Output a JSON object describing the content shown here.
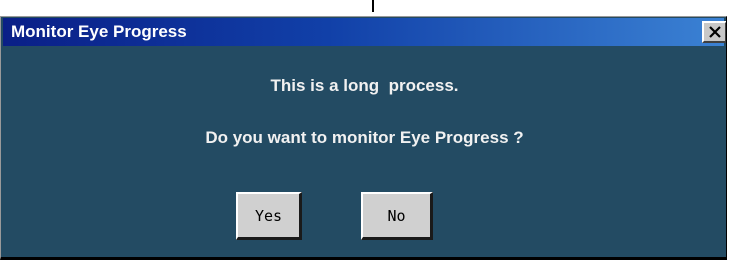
{
  "window": {
    "title": "Monitor Eye Progress"
  },
  "titlebar": {
    "close_icon": "close-icon"
  },
  "message": {
    "line1": "This is a long  process.",
    "line2": "Do you want to monitor Eye Progress ?"
  },
  "buttons": {
    "yes_label": "Yes",
    "no_label": "No"
  },
  "colors": {
    "dialog_background": "#234b63",
    "titlebar_start": "#0a1f87",
    "titlebar_end": "#3b82d4",
    "button_face": "#d0d0d0"
  }
}
